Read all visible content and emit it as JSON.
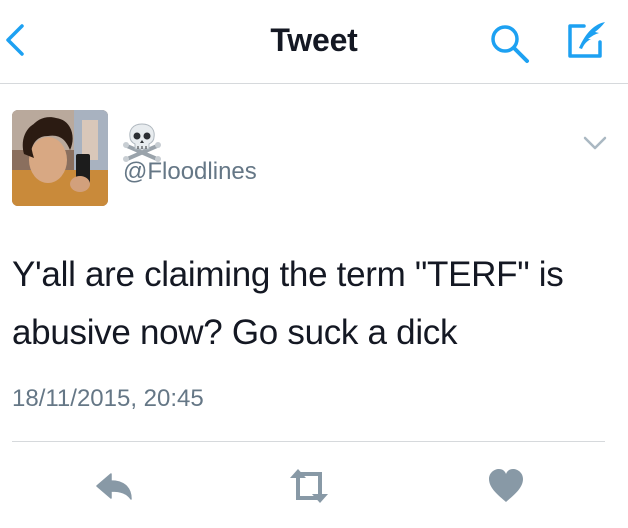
{
  "nav": {
    "title": "Tweet",
    "back_icon": "chevron-left-icon",
    "search_icon": "search-icon",
    "compose_icon": "compose-icon"
  },
  "tweet": {
    "display_name_emoji": "☠️",
    "handle": "@Floodlines",
    "text": "Y'all are claiming the term \"TERF\" is abusive now? Go suck a dick",
    "timestamp": "18/11/2015, 20:45"
  },
  "actions": {
    "reply_icon": "reply-icon",
    "retweet_icon": "retweet-icon",
    "like_icon": "heart-icon"
  },
  "colors": {
    "accent": "#1da1f2",
    "text": "#141823",
    "muted": "#657786",
    "icon_gray": "#8899a6",
    "divider": "#d6d9dc"
  }
}
